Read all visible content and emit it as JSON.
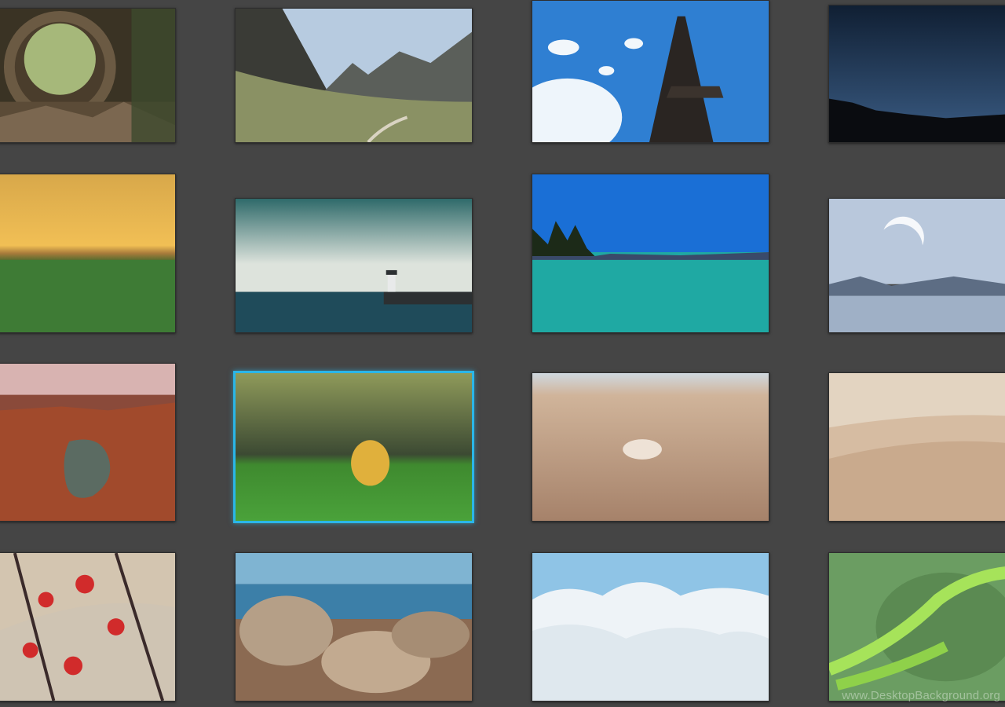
{
  "page": {
    "background": "#454545"
  },
  "gallery": {
    "selection_color": "#2ab6e8",
    "thumbnails": [
      {
        "subject": "hollow-log-tunnel-photo",
        "selected": false
      },
      {
        "subject": "mountain-valley-path-photo",
        "selected": false
      },
      {
        "subject": "eiffel-tower-sky-photo",
        "selected": false
      },
      {
        "subject": "night-sky-silhouette-photo",
        "selected": false
      },
      {
        "subject": "sunset-wheat-field-photo",
        "selected": false
      },
      {
        "subject": "lighthouse-sea-photo",
        "selected": false
      },
      {
        "subject": "turquoise-lake-island-photo",
        "selected": false
      },
      {
        "subject": "moon-over-lake-photo",
        "selected": false
      },
      {
        "subject": "canyon-river-bend-photo",
        "selected": false
      },
      {
        "subject": "autumn-leaf-on-grass-photo",
        "selected": true
      },
      {
        "subject": "seashell-on-sand-photo",
        "selected": false
      },
      {
        "subject": "desert-dunes-photo",
        "selected": false
      },
      {
        "subject": "red-maple-leaves-photo",
        "selected": false
      },
      {
        "subject": "beach-rocks-waves-photo",
        "selected": false
      },
      {
        "subject": "clouds-above-photo",
        "selected": false
      },
      {
        "subject": "green-fern-photo",
        "selected": false
      }
    ]
  },
  "watermark": {
    "text": "www.DesktopBackground.org"
  }
}
